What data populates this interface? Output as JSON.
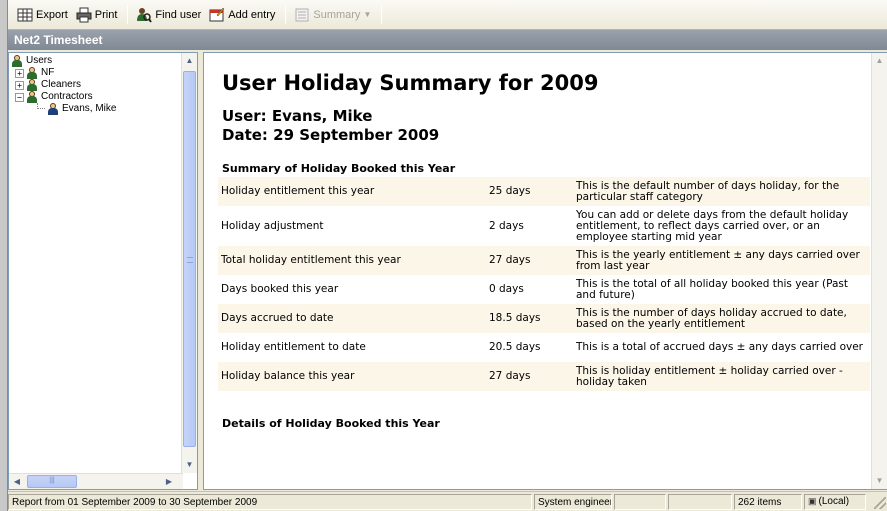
{
  "toolbar": {
    "export_label": "Export",
    "print_label": "Print",
    "find_user_label": "Find user",
    "add_entry_label": "Add entry",
    "summary_label": "Summary"
  },
  "window": {
    "title": "Net2 Timesheet"
  },
  "tree": {
    "root": "Users",
    "items": [
      {
        "label": "NF",
        "expander": "+"
      },
      {
        "label": "Cleaners",
        "expander": "+"
      },
      {
        "label": "Contractors",
        "expander": "−"
      }
    ],
    "child": "Evans, Mike"
  },
  "report": {
    "title": "User Holiday Summary for 2009",
    "user_line": "User: Evans, Mike",
    "date_line": "Date: 29 September 2009",
    "summary_heading": "Summary of Holiday Booked this Year",
    "rows": [
      {
        "label": "Holiday entitlement this year",
        "value": "25 days",
        "note": "This is the default number of days holiday, for the particular staff category"
      },
      {
        "label": "Holiday adjustment",
        "value": "2 days",
        "note": "You can add or delete days from the default holiday entitlement, to reflect days carried over, or an employee starting mid year"
      },
      {
        "label": "Total holiday entitlement this year",
        "value": "27 days",
        "note": "This is the yearly entitlement ± any days carried over from last year"
      },
      {
        "label": "Days booked this year",
        "value": "0 days",
        "note": "This is the total of all holiday booked this year (Past and future)"
      },
      {
        "label": "Days accrued to date",
        "value": "18.5 days",
        "note": "This is the number of days holiday accrued to date, based on the yearly entitlement"
      },
      {
        "label": "Holiday entitlement to date",
        "value": "20.5 days",
        "note": "This is a total of accrued days ± any days carried over"
      },
      {
        "label": "Holiday balance this year",
        "value": "27 days",
        "note": "This is holiday entitlement ± holiday carried over - holiday taken"
      }
    ],
    "details_heading": "Details of Holiday Booked this Year"
  },
  "statusbar": {
    "report_range": "Report from 01 September 2009 to 30 September 2009",
    "role": "System engineer",
    "item_count": "262 items",
    "connection": "(Local)"
  },
  "colors": {
    "title_bar": "#8a939e",
    "row_shade": "#fbf6e8",
    "scroll_thumb": "#c6d3f7"
  }
}
